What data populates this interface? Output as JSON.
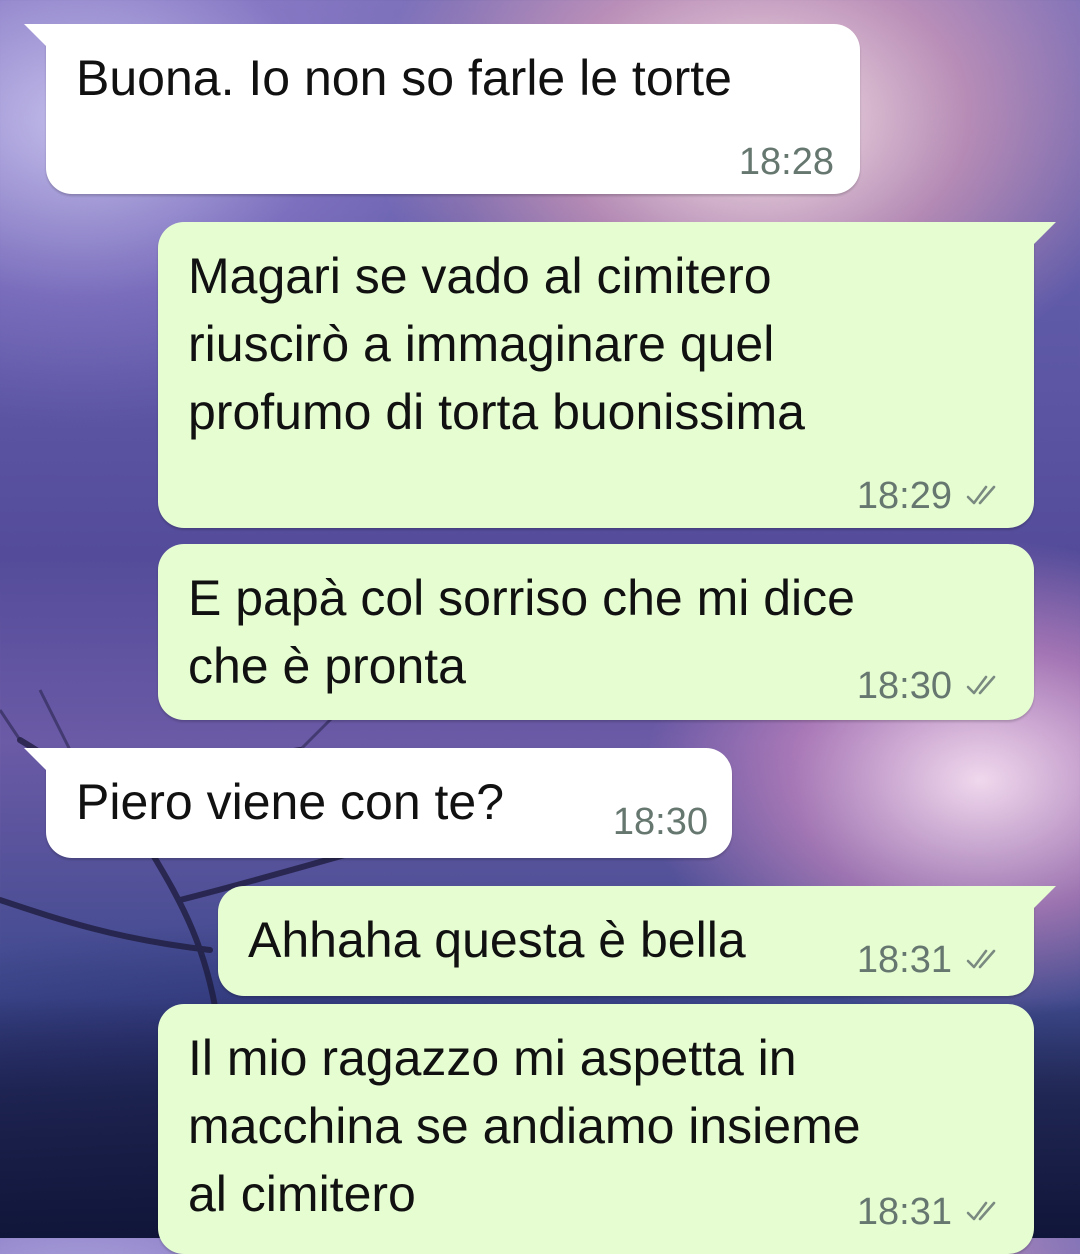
{
  "colors": {
    "incoming_bubble": "#ffffff",
    "outgoing_bubble": "#e6fdd2",
    "timestamp": "#667770",
    "ticks": "#7a8a80"
  },
  "messages": [
    {
      "direction": "incoming",
      "text": "Buona. Io non so farle le torte",
      "time": "18:28",
      "status": ""
    },
    {
      "direction": "outgoing",
      "text": "Magari se vado al cimitero\nriuscirò a immaginare quel\nprofumo di torta buonissima",
      "time": "18:29",
      "status": "double-check-icon"
    },
    {
      "direction": "outgoing",
      "text": "E papà col sorriso che mi dice\nche è pronta",
      "time": "18:30",
      "status": "double-check-icon"
    },
    {
      "direction": "incoming",
      "text": "Piero viene con te?",
      "time": "18:30",
      "status": ""
    },
    {
      "direction": "outgoing",
      "text": "Ahhaha questa è bella",
      "time": "18:31",
      "status": "double-check-icon"
    },
    {
      "direction": "outgoing",
      "text": "Il mio ragazzo mi aspetta in\nmacchina se andiamo insieme\nal cimitero",
      "time": "18:31",
      "status": "double-check-icon"
    }
  ]
}
